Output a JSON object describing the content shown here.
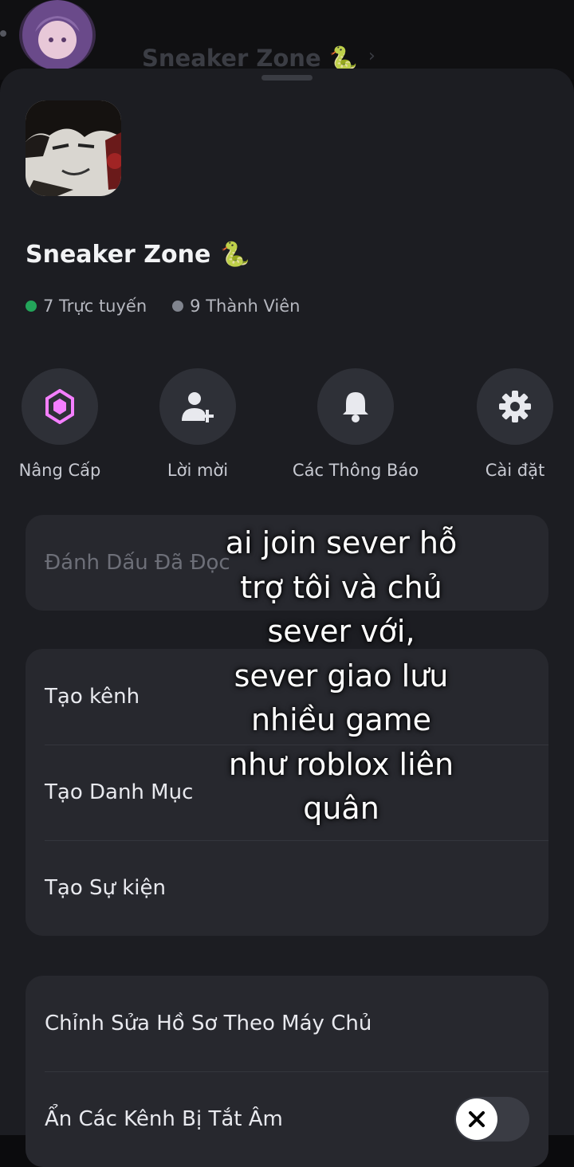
{
  "header": {
    "title": "Sneaker Zone 🐍",
    "chevron": "›"
  },
  "server": {
    "name": "Sneaker Zone",
    "emoji": "🐍",
    "online": "7 Trực tuyến",
    "members": "9 Thành Viên",
    "online_color": "#23a55a",
    "members_color": "#80848e"
  },
  "actions": [
    {
      "label": "Nâng Cấp",
      "icon": "nitro-gem-icon",
      "color": "#f47fff"
    },
    {
      "label": "Lời mời",
      "icon": "add-user-icon"
    },
    {
      "label": "Các Thông Báo",
      "icon": "bell-icon"
    },
    {
      "label": "Cài đặt",
      "icon": "gear-icon"
    }
  ],
  "menu": {
    "mark_read": "Đánh Dấu Đã Đọc",
    "create_channel": "Tạo kênh",
    "create_category": "Tạo Danh Mục",
    "create_event": "Tạo Sự kiện",
    "edit_server_profile": "Chỉnh Sửa Hồ Sơ Theo Máy Chủ",
    "hide_muted": "Ẩn Các Kênh Bị Tắt Âm"
  },
  "toggle": {
    "state": "off"
  },
  "overlay": {
    "lines": [
      "ai join sever hỗ",
      "trợ tôi và chủ",
      "sever với,",
      "sever giao lưu",
      "nhiều game",
      "như roblox liên",
      "quân"
    ]
  }
}
